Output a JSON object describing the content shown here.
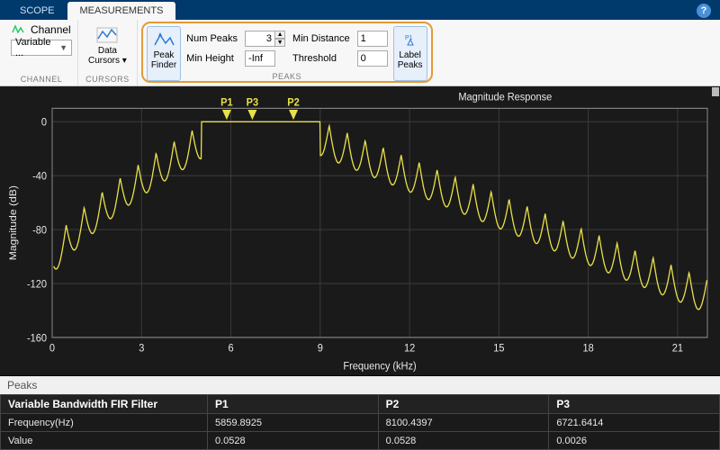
{
  "tabs": {
    "scope": "SCOPE",
    "measurements": "MEASUREMENTS"
  },
  "toolstrip": {
    "channel": {
      "label": "Channel",
      "value": "Variable ...",
      "caption": "CHANNEL"
    },
    "cursors": {
      "label": "Data\nCursors",
      "caption": "CURSORS"
    },
    "peaks": {
      "finder_label": "Peak\nFinder",
      "label_peaks": "Label\nPeaks",
      "num_peaks_label": "Num Peaks",
      "num_peaks_value": "3",
      "min_distance_label": "Min Distance",
      "min_distance_value": "1",
      "min_height_label": "Min Height",
      "min_height_value": "-Inf",
      "threshold_label": "Threshold",
      "threshold_value": "0",
      "caption": "PEAKS"
    }
  },
  "chart_data": {
    "type": "line",
    "title": "Magnitude Response",
    "xlabel": "Frequency (kHz)",
    "ylabel": "Magnitude (dB)",
    "xlim": [
      0,
      22
    ],
    "ylim": [
      -160,
      10
    ],
    "xticks": [
      0,
      3,
      6,
      9,
      12,
      15,
      18,
      21
    ],
    "yticks": [
      -160,
      -120,
      -80,
      -40,
      0
    ],
    "peaks": [
      {
        "label": "P1",
        "x_khz": 5.86,
        "yvalue": 0.05
      },
      {
        "label": "P3",
        "x_khz": 6.72,
        "yvalue": 0.003
      },
      {
        "label": "P2",
        "x_khz": 8.1,
        "yvalue": 0.05
      }
    ]
  },
  "peaks_table": {
    "section_title": "Peaks",
    "columns": [
      "Variable Bandwidth FIR Filter",
      "P1",
      "P2",
      "P3"
    ],
    "rows": [
      {
        "label": "Frequency(Hz)",
        "values": [
          "5859.8925",
          "8100.4397",
          "6721.6414"
        ]
      },
      {
        "label": "Value",
        "values": [
          "0.0528",
          "0.0528",
          "0.0026"
        ]
      }
    ]
  }
}
